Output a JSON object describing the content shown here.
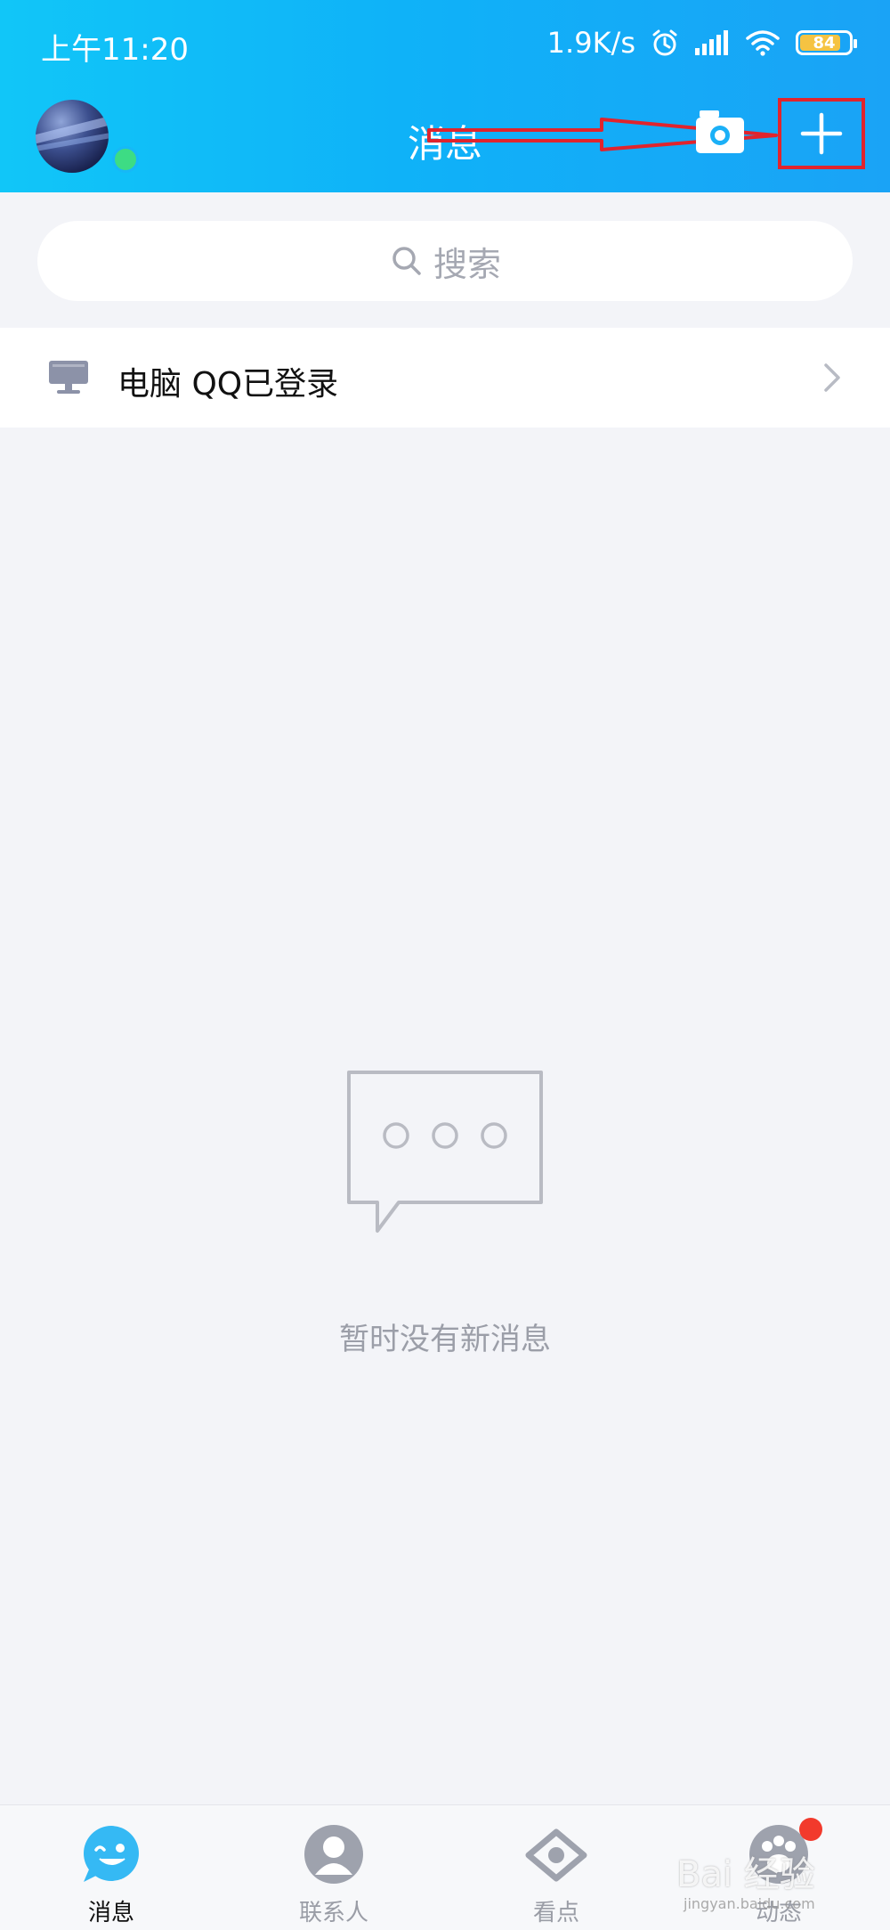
{
  "status_bar": {
    "time": "上午11:20",
    "network_speed": "1.9K/s",
    "battery": "84",
    "battery_level_percent": 84,
    "icons": [
      "alarm-icon",
      "signal-icon",
      "wifi-icon",
      "battery-icon"
    ]
  },
  "header": {
    "title": "消息",
    "actions": [
      "camera-icon",
      "plus-icon"
    ]
  },
  "search": {
    "placeholder": "搜索"
  },
  "login_notice": {
    "text": "电脑 QQ已登录"
  },
  "empty_state": {
    "message": "暂时没有新消息"
  },
  "bottom_nav": {
    "items": [
      {
        "label": "消息",
        "icon": "message-icon",
        "active": true
      },
      {
        "label": "联系人",
        "icon": "contacts-icon",
        "active": false
      },
      {
        "label": "看点",
        "icon": "eye-icon",
        "active": false
      },
      {
        "label": "动态",
        "icon": "paw-icon",
        "active": false
      }
    ]
  },
  "watermark": {
    "text": "Bai 经验",
    "sub": "jingyan.baidu.com"
  },
  "colors": {
    "header_gradient_start": "#11c6f8",
    "header_gradient_end": "#1aa3f6",
    "background": "#f3f4f8",
    "annotation_red": "#e0242d",
    "online_green": "#3ddc84",
    "badge_red": "#f23a2c"
  }
}
